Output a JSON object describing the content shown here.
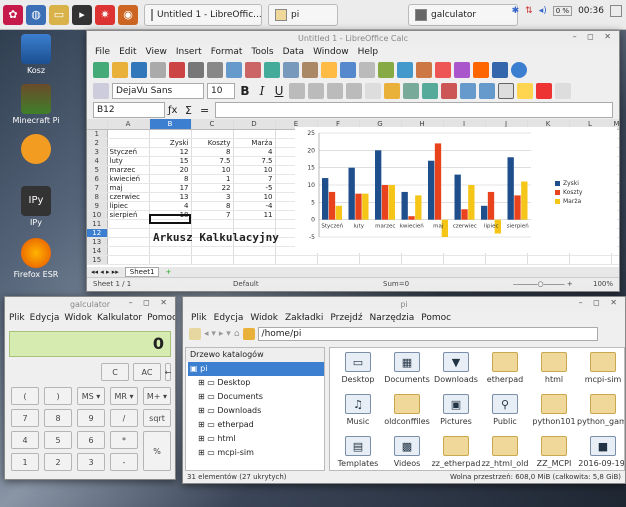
{
  "taskbar": {
    "tasks": [
      "Untitled 1 - LibreOffic...",
      "pi",
      "galculator"
    ],
    "clock": "00:36",
    "cpu": "0 %"
  },
  "desktop": {
    "icons": [
      "Kosz",
      "Minecraft Pi",
      "",
      "IPy",
      "Firefox ESR"
    ]
  },
  "calc": {
    "title": "Untitled 1 - LibreOffice Calc",
    "menu": [
      "File",
      "Edit",
      "View",
      "Insert",
      "Format",
      "Tools",
      "Data",
      "Window",
      "Help"
    ],
    "font": "DejaVu Sans",
    "size": "10",
    "cellref": "B12",
    "cols": [
      "",
      "A",
      "B",
      "C",
      "D",
      "E",
      "F",
      "G",
      "H",
      "I",
      "J",
      "K",
      "L",
      "M"
    ],
    "headers": {
      "b": "Zyski",
      "c": "Koszty",
      "d": "Marża"
    },
    "rows": [
      {
        "r": "1",
        "a": "",
        "b": "",
        "c": "",
        "d": ""
      },
      {
        "r": "2",
        "a": "",
        "b": "Zyski",
        "c": "Koszty",
        "d": "Marża"
      },
      {
        "r": "3",
        "a": "Styczeń",
        "b": "12",
        "c": "8",
        "d": "4"
      },
      {
        "r": "4",
        "a": "luty",
        "b": "15",
        "c": "7.5",
        "d": "7.5"
      },
      {
        "r": "5",
        "a": "marzec",
        "b": "20",
        "c": "10",
        "d": "10"
      },
      {
        "r": "6",
        "a": "kwiecień",
        "b": "8",
        "c": "1",
        "d": "7"
      },
      {
        "r": "7",
        "a": "maj",
        "b": "17",
        "c": "22",
        "d": "-5"
      },
      {
        "r": "8",
        "a": "czerwiec",
        "b": "13",
        "c": "3",
        "d": "10"
      },
      {
        "r": "9",
        "a": "lipiec",
        "b": "4",
        "c": "8",
        "d": "-4"
      },
      {
        "r": "10",
        "a": "sierpień",
        "b": "18",
        "c": "7",
        "d": "11"
      },
      {
        "r": "11",
        "a": "",
        "b": "",
        "c": "",
        "d": ""
      },
      {
        "r": "12",
        "a": "",
        "b": "",
        "c": "",
        "d": ""
      },
      {
        "r": "13",
        "a": "",
        "b": "",
        "c": "",
        "d": ""
      },
      {
        "r": "14",
        "a": "",
        "b": "",
        "c": "",
        "d": ""
      },
      {
        "r": "15",
        "a": "",
        "b": "",
        "c": "",
        "d": ""
      }
    ],
    "big_text": "Arkusz Kalkulacyjny",
    "sheet_tab": "Sheet1",
    "status": {
      "sheet": "Sheet 1 / 1",
      "style": "Default",
      "sum": "Sum=0",
      "zoom": "100%"
    }
  },
  "chart_data": {
    "type": "bar",
    "categories": [
      "Styczeń",
      "luty",
      "marzec",
      "kwiecień",
      "maj",
      "czerwiec",
      "lipiec",
      "sierpień"
    ],
    "series": [
      {
        "name": "Zyski",
        "color": "#1f4e8c",
        "values": [
          12,
          15,
          20,
          8,
          17,
          13,
          4,
          18
        ]
      },
      {
        "name": "Koszty",
        "color": "#e8431c",
        "values": [
          8,
          7.5,
          10,
          1,
          22,
          3,
          8,
          7
        ]
      },
      {
        "name": "Marża",
        "color": "#f5c518",
        "values": [
          4,
          7.5,
          10,
          7,
          -5,
          10,
          -4,
          11
        ]
      }
    ],
    "ylim": [
      -5,
      25
    ],
    "yticks": [
      "25",
      "20",
      "15",
      "10",
      "5",
      "0",
      "-5"
    ],
    "legend": "right"
  },
  "galc": {
    "title": "galculator",
    "menu": [
      "Plik",
      "Edycja",
      "Widok",
      "Kalkulator",
      "Pomoc"
    ],
    "display": "0",
    "buttons": [
      "C",
      "AC",
      "←",
      "(",
      ")",
      "MS ▾",
      "MR ▾",
      "M+ ▾",
      "7",
      "8",
      "9",
      "/",
      "sqrt",
      "4",
      "5",
      "6",
      "*",
      "%",
      "1",
      "2",
      "3",
      "-",
      "=",
      "0",
      ".",
      "+/-",
      "+"
    ]
  },
  "fm": {
    "title": "pi",
    "menu": [
      "Plik",
      "Edycja",
      "Widok",
      "Zakładki",
      "Przejdź",
      "Narzędzia",
      "Pomoc"
    ],
    "path": "/home/pi",
    "tree_label": "Drzewo katalogów",
    "tree": [
      "pi",
      "Desktop",
      "Documents",
      "Downloads",
      "etherpad",
      "html",
      "mcpi-sim"
    ],
    "items": [
      "Desktop",
      "Documents",
      "Downloads",
      "etherpad",
      "html",
      "mcpi-sim",
      "Music",
      "oldconffiles",
      "Pictures",
      "Public",
      "python101",
      "python_games",
      "Templates",
      "Videos",
      "zz_etherpad",
      "zz_html_old",
      "ZZ_MCPI",
      "2016-09-19-"
    ],
    "status_left": "31 elementów (27 ukrytych)",
    "status_right": "Wolna przestrzeń: 608,0 MiB (całkowita: 5,8 GiB)"
  }
}
